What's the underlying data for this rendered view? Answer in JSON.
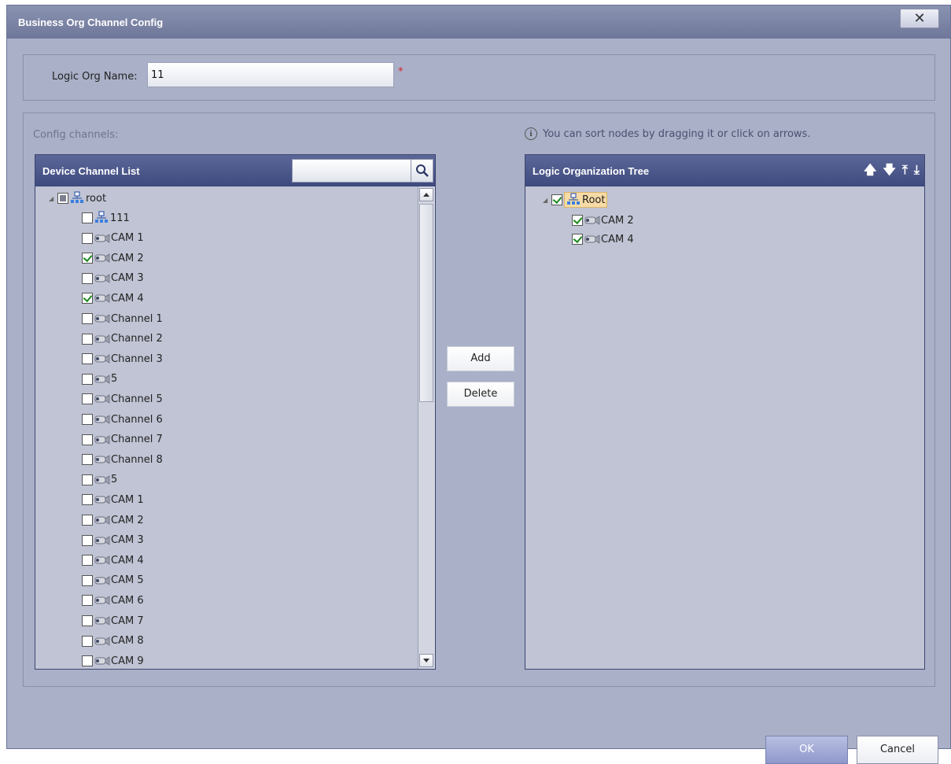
{
  "dialog": {
    "title": "Business Org Channel Config",
    "close_symbol": "✕"
  },
  "form": {
    "logic_org_label": "Logic Org Name:",
    "logic_org_value": "11",
    "required_mark": "*"
  },
  "config": {
    "label": "Config channels:",
    "hint": "You can sort nodes by dragging it or click on arrows."
  },
  "device_list": {
    "title": "Device Channel List",
    "search_value": "",
    "root_label": "root",
    "items": [
      {
        "label": "111",
        "icon": "org-icon",
        "checked": false
      },
      {
        "label": "CAM 1",
        "icon": "camera-icon",
        "checked": false
      },
      {
        "label": "CAM 2",
        "icon": "camera-icon",
        "checked": true
      },
      {
        "label": "CAM 3",
        "icon": "camera-icon",
        "checked": false
      },
      {
        "label": "CAM 4",
        "icon": "camera-icon",
        "checked": true
      },
      {
        "label": "Channel 1",
        "icon": "camera-icon",
        "checked": false
      },
      {
        "label": "Channel 2",
        "icon": "camera-icon",
        "checked": false
      },
      {
        "label": "Channel 3",
        "icon": "camera-icon",
        "checked": false
      },
      {
        "label": "5",
        "icon": "camera-icon",
        "checked": false
      },
      {
        "label": "Channel 5",
        "icon": "camera-icon",
        "checked": false
      },
      {
        "label": "Channel 6",
        "icon": "camera-icon",
        "checked": false
      },
      {
        "label": "Channel 7",
        "icon": "camera-icon",
        "checked": false
      },
      {
        "label": "Channel 8",
        "icon": "camera-icon",
        "checked": false
      },
      {
        "label": "5",
        "icon": "camera-icon",
        "checked": false
      },
      {
        "label": "CAM 1",
        "icon": "camera-icon",
        "checked": false
      },
      {
        "label": "CAM 2",
        "icon": "camera-icon",
        "checked": false
      },
      {
        "label": "CAM 3",
        "icon": "camera-icon",
        "checked": false
      },
      {
        "label": "CAM 4",
        "icon": "camera-icon",
        "checked": false
      },
      {
        "label": "CAM 5",
        "icon": "camera-icon",
        "checked": false
      },
      {
        "label": "CAM 6",
        "icon": "camera-icon",
        "checked": false
      },
      {
        "label": "CAM 7",
        "icon": "camera-icon",
        "checked": false
      },
      {
        "label": "CAM 8",
        "icon": "camera-icon",
        "checked": false
      },
      {
        "label": "CAM 9",
        "icon": "camera-icon",
        "checked": false
      }
    ]
  },
  "actions": {
    "add_label": "Add",
    "delete_label": "Delete"
  },
  "logic_tree": {
    "title": "Logic Organization Tree",
    "root_label": "Root",
    "items": [
      {
        "label": "CAM 2",
        "icon": "camera-icon",
        "checked": true
      },
      {
        "label": "CAM 4",
        "icon": "camera-icon",
        "checked": true
      }
    ],
    "sort_arrows": [
      "up-arrow-icon",
      "down-arrow-icon",
      "move-top-icon",
      "move-bottom-icon"
    ]
  },
  "footer": {
    "ok_label": "OK",
    "cancel_label": "Cancel"
  }
}
